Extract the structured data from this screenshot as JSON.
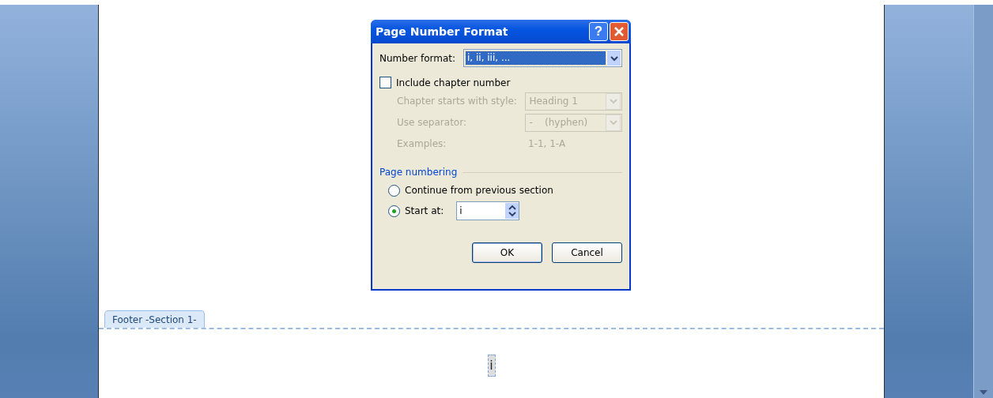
{
  "dialog": {
    "title": "Page Number Format",
    "help_label": "?",
    "number_format": {
      "label": "Number format:",
      "value": "i, ii, iii, ...",
      "focused": true
    },
    "include_chapter": {
      "label": "Include chapter number",
      "checked": false
    },
    "chapter_rows": [
      {
        "label": "Chapter starts with style:",
        "value": "Heading 1",
        "kind": "dropdown",
        "disabled": true
      },
      {
        "label": "Use separator:",
        "value": "-    (hyphen)",
        "kind": "dropdown",
        "disabled": true
      },
      {
        "label": "Examples:",
        "value": "1-1, 1-A",
        "kind": "text",
        "disabled": true
      }
    ],
    "page_numbering": {
      "title": "Page numbering",
      "options": [
        {
          "label": "Continue from previous section",
          "selected": false,
          "kind": "plain"
        },
        {
          "label": "Start at:",
          "selected": true,
          "kind": "spin",
          "value": "i"
        }
      ]
    },
    "buttons": [
      {
        "label": "OK",
        "default": true
      },
      {
        "label": "Cancel",
        "default": false
      }
    ]
  },
  "footer": {
    "tab": "Footer -Section 1-",
    "page_number": "i"
  }
}
